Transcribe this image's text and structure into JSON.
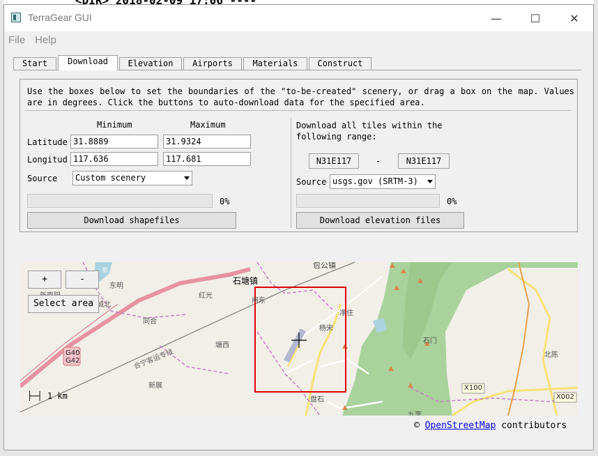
{
  "background": {
    "text": "<DIR>     2018-02-09 17:06  ----"
  },
  "window": {
    "title": "TerraGear GUI",
    "minimize": "—",
    "maximize": "☐",
    "close": "✕"
  },
  "menu": {
    "file": "File",
    "help": "Help"
  },
  "tabs": [
    "Start",
    "Download",
    "Elevation",
    "Airports",
    "Materials",
    "Construct"
  ],
  "active_tab": "Download",
  "download": {
    "description": "Use the boxes below to set the boundaries of the \"to-be-created\" scenery, or drag a box on the map. Values are in degrees. Click the buttons to auto-download data for the specified area.",
    "minimum_label": "Minimum",
    "maximum_label": "Maximum",
    "latitude_label": "Latitude",
    "longitude_label": "Longitud",
    "lat_min": "31.8889",
    "lat_max": "31.9324",
    "lon_min": "117.636",
    "lon_max": "117.681",
    "source_label": "Source",
    "source_value": "Custom scenery",
    "progress_percent": "0%",
    "download_shapefiles": "Download shapefiles"
  },
  "elevation": {
    "range_text": "Download all tiles within the following range:",
    "tile_from": "N31E117",
    "separator": "-",
    "tile_to": "N31E117",
    "source_label": "Source",
    "source_value": "usgs.gov (SRTM-3)",
    "progress_percent": "0%",
    "download_elevation": "Download elevation files"
  },
  "map": {
    "zoom_in": "+",
    "zoom_out": "-",
    "select_area": "Select area",
    "scale": "1 km",
    "places": [
      "石塘镇",
      "包公镇",
      "东明",
      "新南阳",
      "城北",
      "红光",
      "同合",
      "闸东",
      "净住",
      "杨宋",
      "石门",
      "北陈",
      "塘西",
      "新展",
      "盘石",
      "九李",
      "合宁客运专线"
    ],
    "road_labels": [
      "G40",
      "G42",
      "X100",
      "X002"
    ],
    "colors": {
      "selection": "#e00000",
      "forest": "#a9d29d",
      "motorway": "#e892a2",
      "trunk": "#f7e277",
      "water": "#aad3df"
    }
  },
  "credit": {
    "symbol": "©",
    "link": "OpenStreetMap",
    "suffix": " contributors"
  }
}
